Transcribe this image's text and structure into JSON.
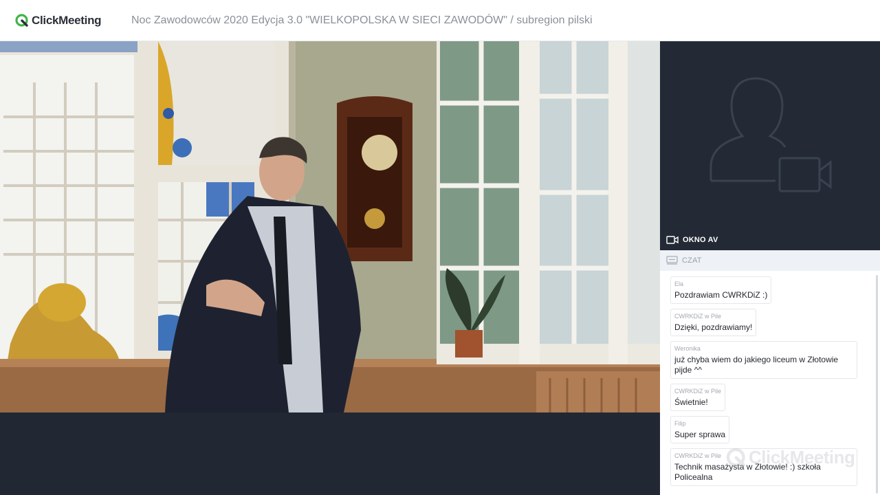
{
  "app": {
    "brand": "ClickMeeting",
    "event_title": "Noc Zawodowców 2020 Edycja 3.0 \"WIELKOPOLSKA W SIECI ZAWODÓW\" / subregion pilski"
  },
  "panels": {
    "av_label": "OKNO AV",
    "chat_label": "CZAT"
  },
  "chat": {
    "messages": [
      {
        "author": "Ela",
        "text": "Pozdrawiam CWRKDiZ :)"
      },
      {
        "author": "CWRKDiZ w Pile",
        "text": "Dzięki, pozdrawiamy!"
      },
      {
        "author": "Weronika",
        "text": "już chyba wiem do jakiego liceum w Złotowie pijde ^^"
      },
      {
        "author": "CWRKDiZ w Pile",
        "text": "Świetnie!"
      },
      {
        "author": "Filip",
        "text": "Super sprawa"
      },
      {
        "author": "CWRKDiZ w Pile",
        "text": "Technik masażysta w Złotowie! :) szkoła Policealna"
      }
    ]
  },
  "colors": {
    "brand_green": "#3fb54a",
    "stage_bg": "#212733",
    "chat_header_bg": "#eef1f6"
  },
  "icons": {
    "logo": "clickmeeting-logo-icon",
    "av": "video-camera-icon",
    "chat": "chat-icon",
    "placeholder": "user-camera-placeholder-icon"
  }
}
